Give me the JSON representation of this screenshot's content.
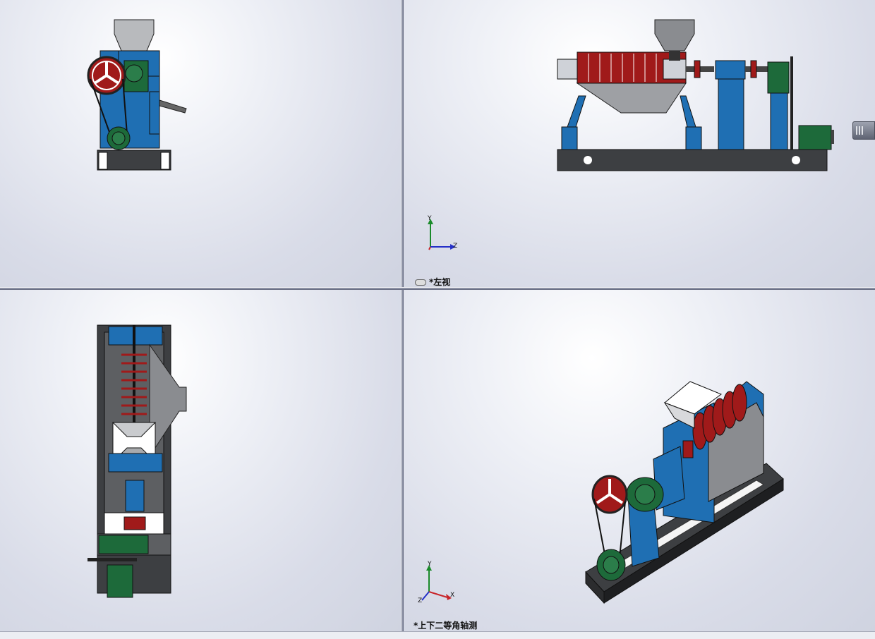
{
  "views": {
    "left_label": "*左视",
    "iso_label": "*上下二等角轴测"
  },
  "triad": {
    "left": {
      "y": "Y",
      "z": "Z"
    },
    "iso": {
      "y": "Y",
      "x": "X",
      "z": "Z"
    }
  },
  "colors": {
    "blue": "#1f6fb3",
    "red": "#a01a1a",
    "green": "#1d6a3a",
    "dark_frame": "#3d3f42",
    "hopper": "#b8babd"
  }
}
